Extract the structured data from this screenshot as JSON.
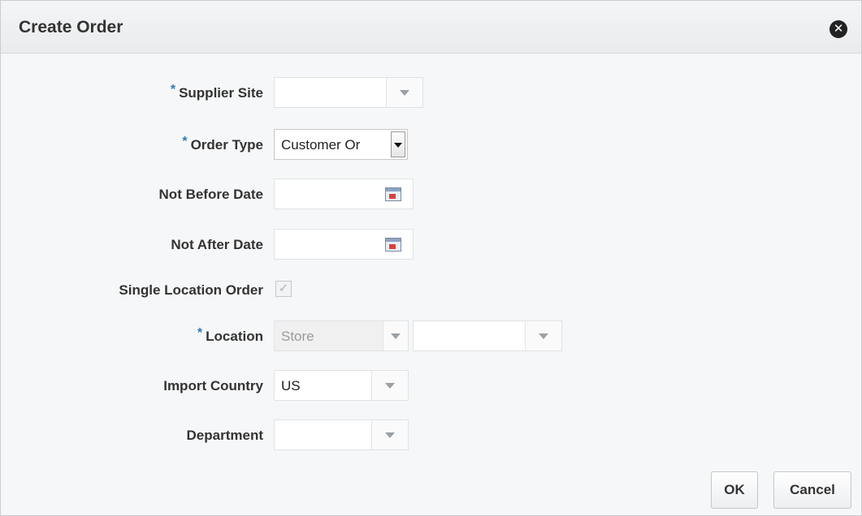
{
  "dialog": {
    "title": "Create Order",
    "close_icon": "close-circle-icon"
  },
  "form": {
    "supplier_site": {
      "label": "Supplier Site",
      "required": true,
      "value": ""
    },
    "order_type": {
      "label": "Order Type",
      "required": true,
      "value": "Customer Or"
    },
    "not_before_date": {
      "label": "Not Before Date",
      "value": "",
      "icon": "calendar-icon"
    },
    "not_after_date": {
      "label": "Not After Date",
      "value": "",
      "icon": "calendar-icon"
    },
    "single_location_order": {
      "label": "Single Location Order",
      "checked": true,
      "disabled": true,
      "mark": "✓"
    },
    "location": {
      "label": "Location",
      "required": true,
      "type_value": "Store",
      "value": ""
    },
    "import_country": {
      "label": "Import Country",
      "value": "US"
    },
    "department": {
      "label": "Department",
      "value": ""
    }
  },
  "required_marker": "*",
  "buttons": {
    "ok_label": "OK",
    "cancel_label": "Cancel"
  },
  "colors": {
    "required_marker": "#2e7bb8",
    "header_bg": "#eceef0"
  }
}
